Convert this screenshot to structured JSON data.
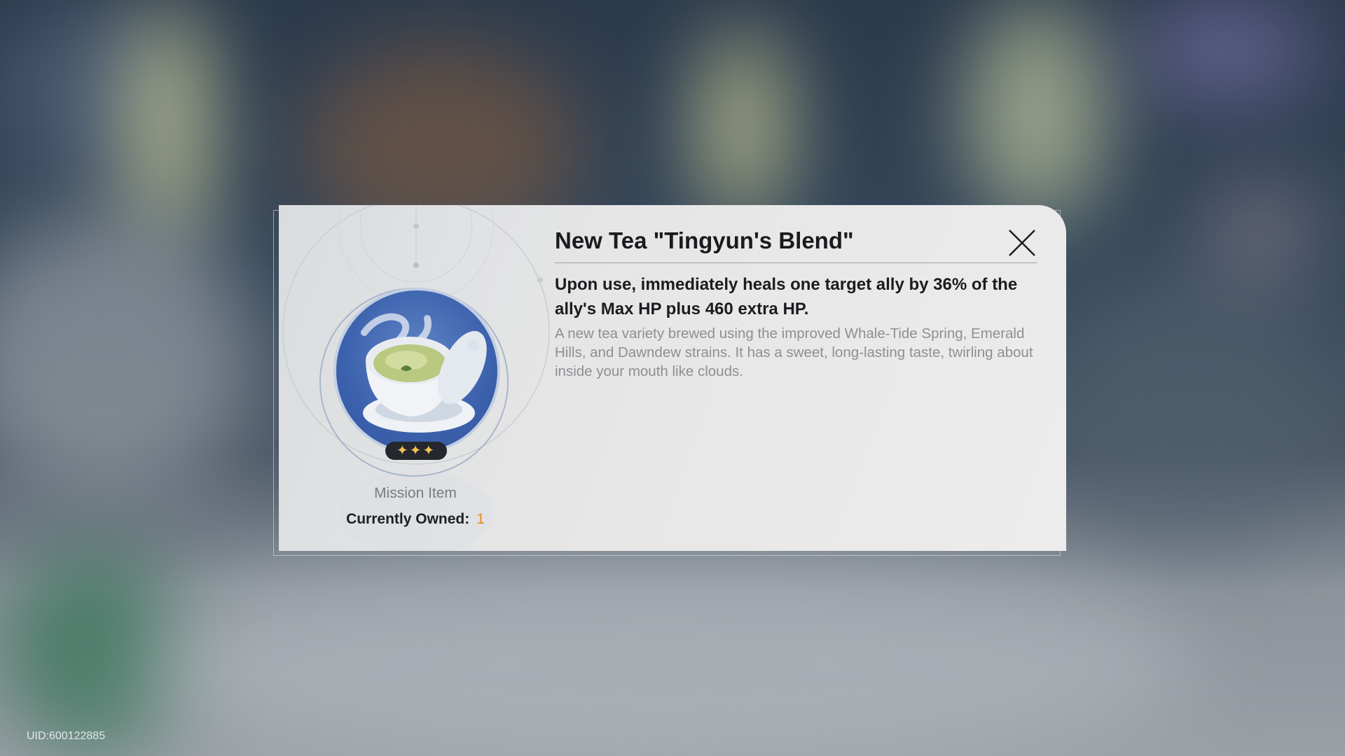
{
  "item": {
    "name": "New Tea \"Tingyun's Blend\"",
    "effect": "Upon use, immediately heals one target ally by 36% of the ally's Max HP plus 460 extra HP.",
    "description": "A new tea variety brewed using the improved Whale-Tide Spring, Emerald Hills, and Dawndew strains. It has a sweet, long-lasting taste, twirling about inside your mouth like clouds.",
    "rarity_stars": "✦✦✦",
    "type": "Mission Item",
    "owned_label": "Currently Owned:",
    "owned_count": "1",
    "icon": "tea-gaiwan-icon"
  },
  "footer": {
    "uid": "UID:600122885"
  },
  "colors": {
    "accent_count": "#e88a1a",
    "icon_bg": "#3c61ad",
    "panel": "#e6e6e6"
  }
}
